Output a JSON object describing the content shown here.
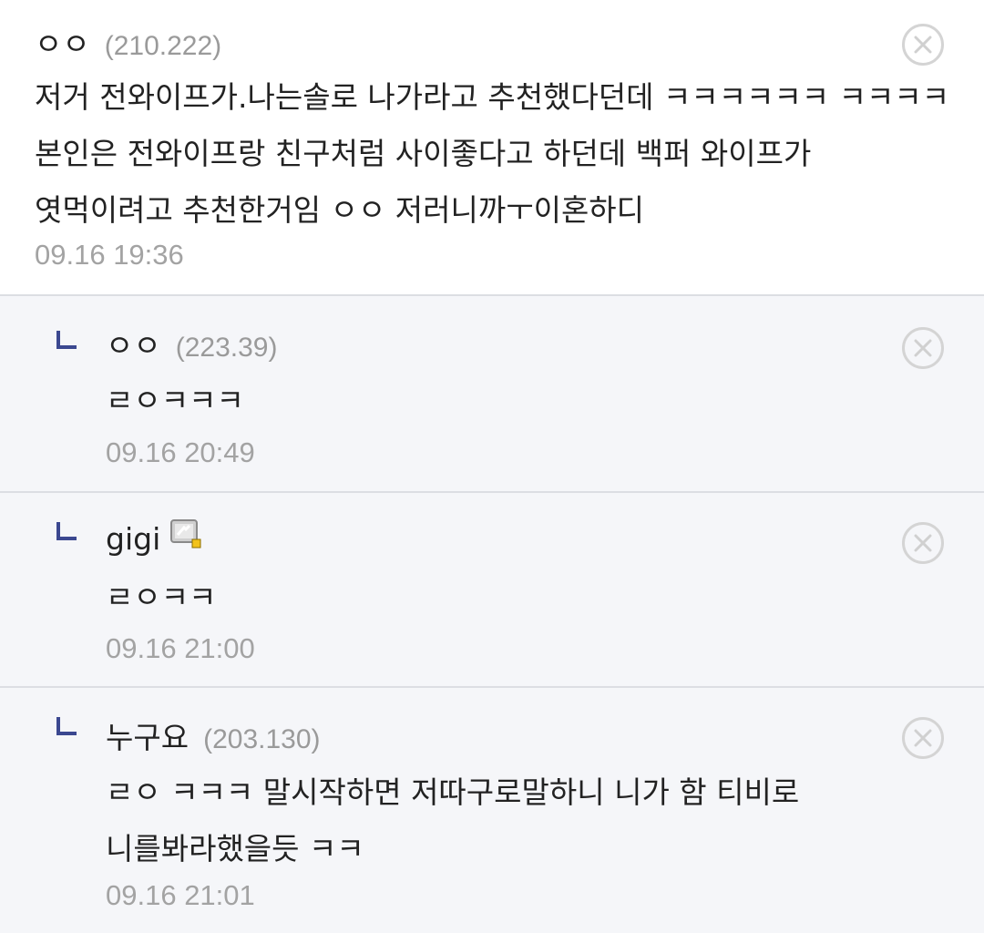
{
  "comments": [
    {
      "nickname": "ㅇㅇ",
      "ip": "(210.222)",
      "text": "저거 전와이프가.나는솔로 나가라고 추천했다던데 ㅋㅋㅋㅋㅋㅋ ㅋㅋㅋㅋ 본인은 전와이프랑 친구처럼 사이좋다고 하던데 백퍼 와이프가 엿먹이려고 추천한거임 ㅇㅇ 저러니까ㅜ이혼하디",
      "date": "09.16 19:36"
    },
    {
      "nickname": "ㅇㅇ",
      "ip": "(223.39)",
      "text": "ㄹㅇㅋㅋㅋ",
      "date": "09.16 20:49"
    },
    {
      "nickname": "gigi",
      "ip": "",
      "text": "ㄹㅇㅋㅋ",
      "date": "09.16 21:00",
      "icon": "gallery-nickname-icon"
    },
    {
      "nickname": "누구요",
      "ip": "(203.130)",
      "text": "ㄹㅇ ㅋㅋㅋ 말시작하면 저따구로말하니 니가 함 티비로 니를봐라했을듯 ㅋㅋ",
      "date": "09.16 21:01"
    }
  ],
  "icons": {
    "delete": "close-circle-icon",
    "reply_marker": "reply-arrow-icon"
  },
  "colors": {
    "reply_background": "#f5f6f9",
    "reply_arrow": "#3b4890",
    "meta_text": "#9a9a9a",
    "divider": "#dcdee3"
  }
}
